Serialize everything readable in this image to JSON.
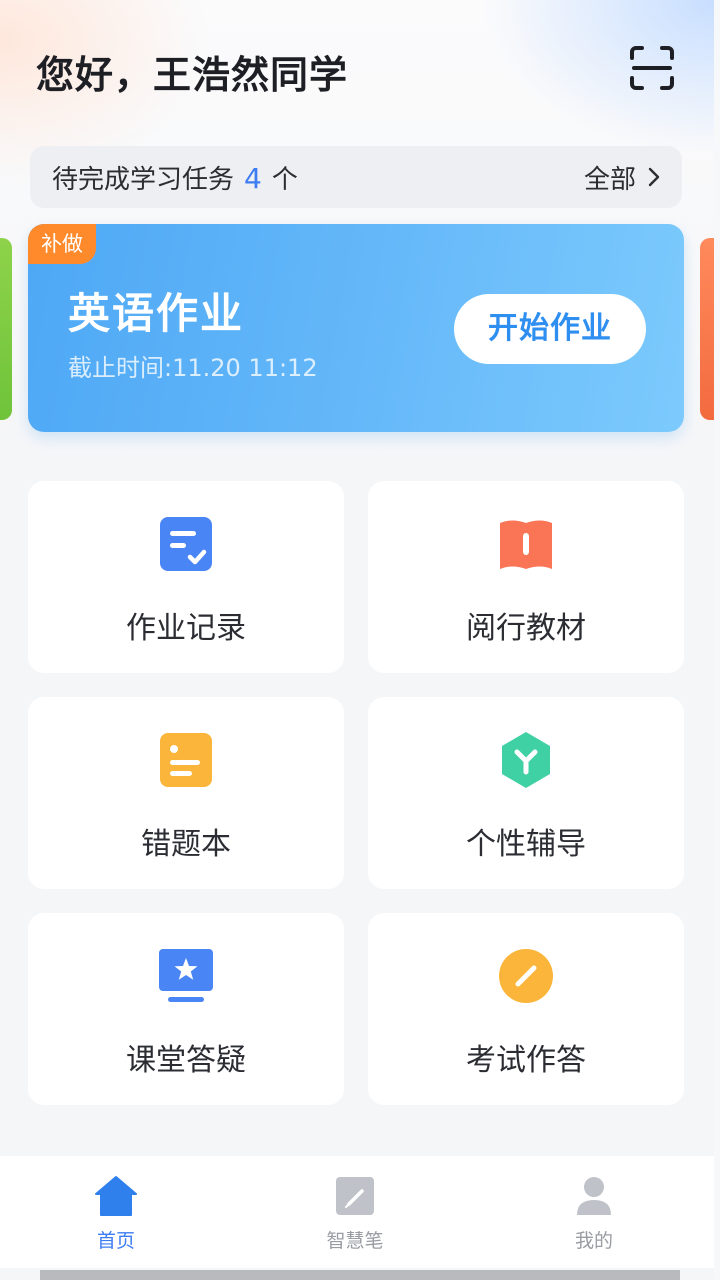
{
  "header": {
    "greeting": "您好，王浩然同学",
    "scan_icon": "scan-icon"
  },
  "tasks": {
    "prefix": "待完成学习任务",
    "count": "4",
    "unit": "个",
    "all_label": "全部"
  },
  "homework": {
    "badge": "补做",
    "title": "英语作业",
    "deadline": "截止时间:11.20 11:12",
    "start_label": "开始作业"
  },
  "grid": [
    {
      "label": "作业记录",
      "icon": "homework-record-icon",
      "color": "#4a85f6"
    },
    {
      "label": "阅行教材",
      "icon": "textbook-icon",
      "color": "#fa7456"
    },
    {
      "label": "错题本",
      "icon": "wrong-questions-icon",
      "color": "#fbb53b"
    },
    {
      "label": "个性辅导",
      "icon": "tutoring-icon",
      "color": "#3fd0a3"
    },
    {
      "label": "课堂答疑",
      "icon": "classroom-qa-icon",
      "color": "#4a85f6"
    },
    {
      "label": "考试作答",
      "icon": "exam-answer-icon",
      "color": "#fbb53b"
    }
  ],
  "tabs": [
    {
      "label": "首页",
      "icon": "home-icon",
      "active": true
    },
    {
      "label": "智慧笔",
      "icon": "smart-pen-icon",
      "active": false
    },
    {
      "label": "我的",
      "icon": "profile-icon",
      "active": false
    }
  ],
  "colors": {
    "accent": "#3d7cf2",
    "inactive": "#9a9ca3"
  }
}
